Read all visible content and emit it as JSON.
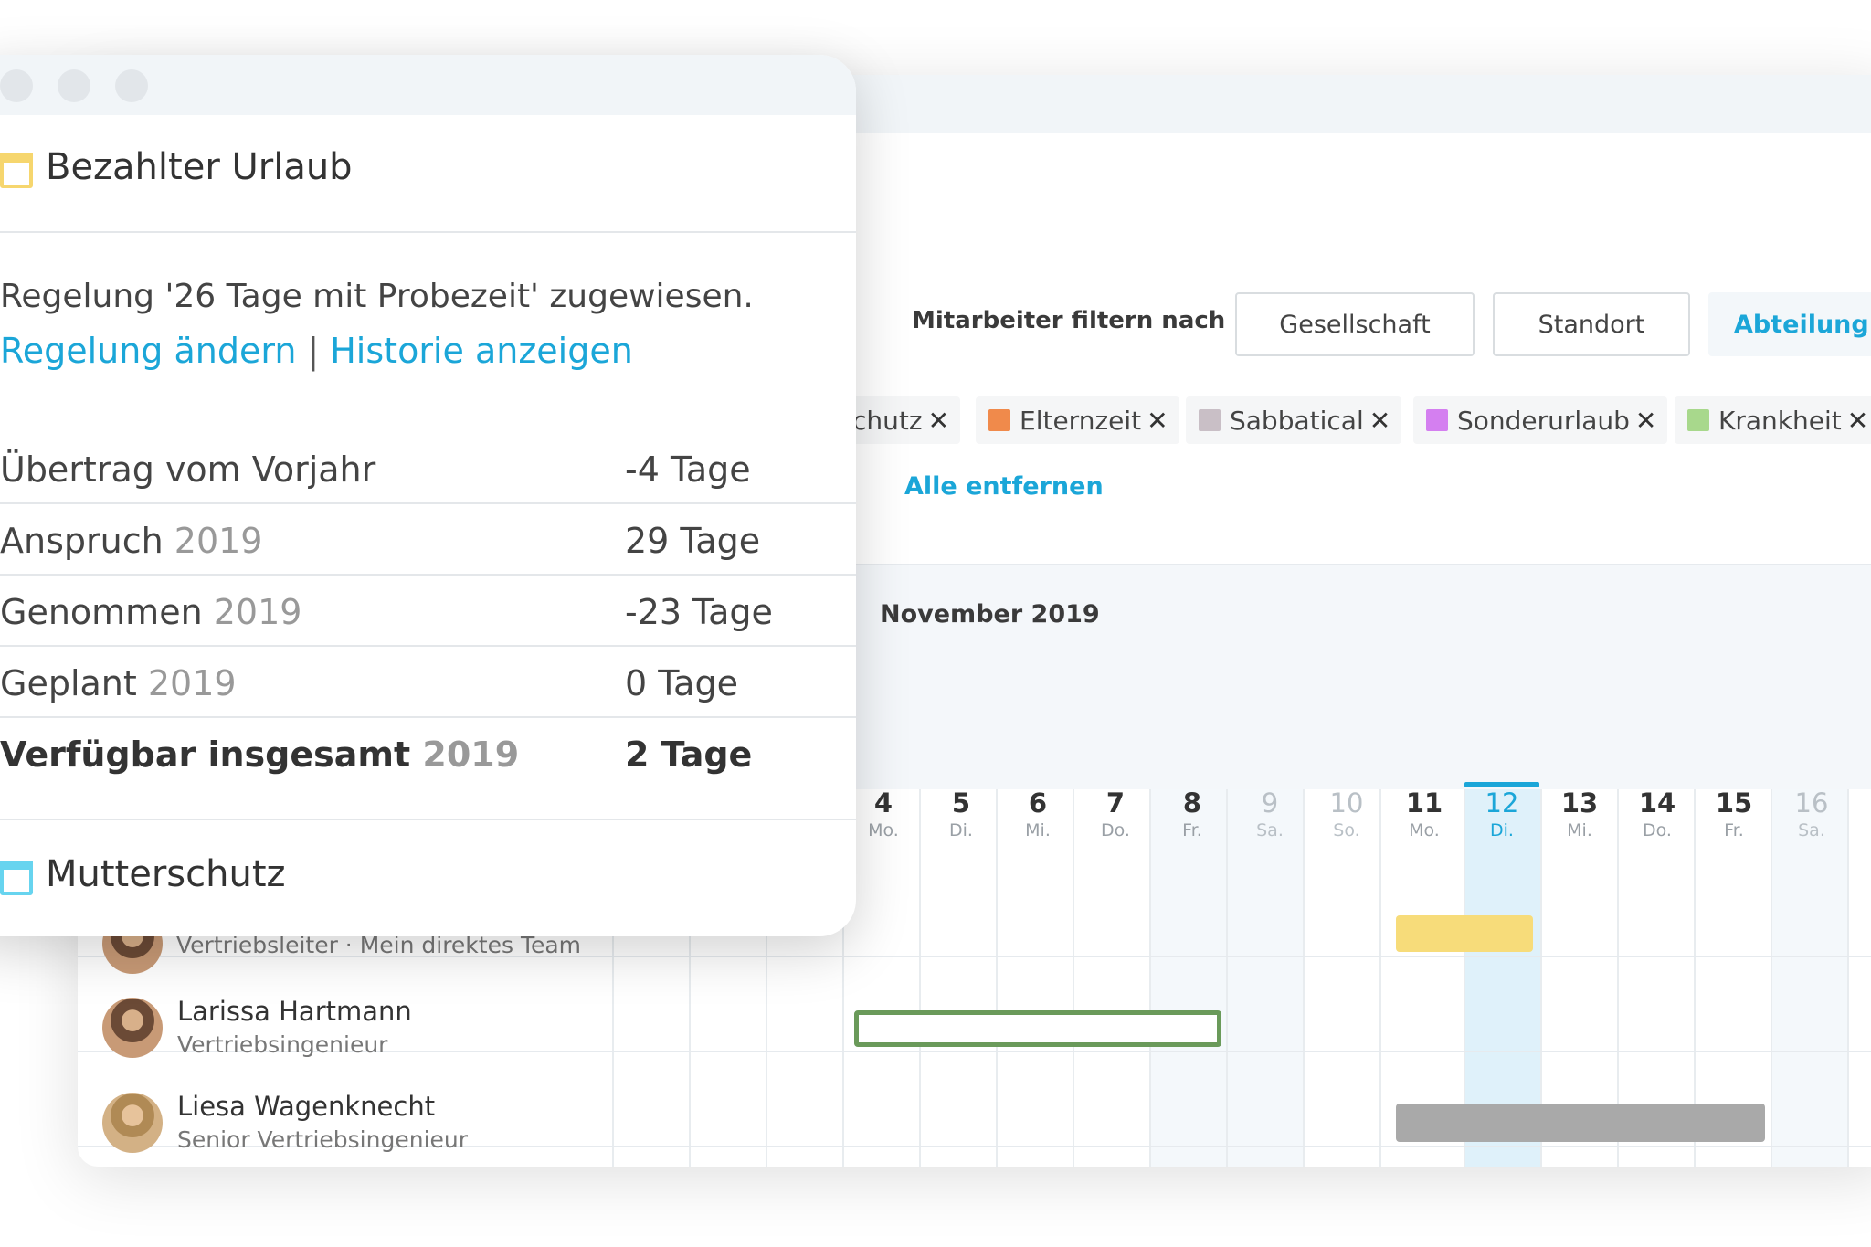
{
  "filter": {
    "label": "Mitarbeiter filtern nach",
    "buttons": [
      "Gesellschaft",
      "Standort",
      "Abteilung ("
    ]
  },
  "chips": [
    {
      "label": "chutz",
      "color": ""
    },
    {
      "label": "Elternzeit",
      "color": "#f08a4b"
    },
    {
      "label": "Sabbatical",
      "color": "#c9bfc6"
    },
    {
      "label": "Sonderurlaub",
      "color": "#d47ff0"
    },
    {
      "label": "Krankheit",
      "color": "#a8d88c"
    }
  ],
  "chip_close": "✕",
  "remove_all": "Alle entfernen",
  "calendar": {
    "month": "November 2019",
    "days": [
      {
        "n": "4",
        "d": "Mo."
      },
      {
        "n": "5",
        "d": "Di."
      },
      {
        "n": "6",
        "d": "Mi."
      },
      {
        "n": "7",
        "d": "Do."
      },
      {
        "n": "8",
        "d": "Fr."
      },
      {
        "n": "9",
        "d": "Sa."
      },
      {
        "n": "10",
        "d": "So."
      },
      {
        "n": "11",
        "d": "Mo."
      },
      {
        "n": "12",
        "d": "Di."
      },
      {
        "n": "13",
        "d": "Mi."
      },
      {
        "n": "14",
        "d": "Do."
      },
      {
        "n": "15",
        "d": "Fr."
      },
      {
        "n": "16",
        "d": "Sa."
      }
    ]
  },
  "employees": [
    {
      "name": "",
      "role": "Vertriebsleiter · Mein direktes Team"
    },
    {
      "name": "Larissa Hartmann",
      "role": "Vertriebsingenieur"
    },
    {
      "name": "Liesa Wagenknecht",
      "role": "Senior Vertriebsingenieur"
    }
  ],
  "popup": {
    "section1_title": "Bezahlter Urlaub",
    "rule_text": "Regelung '26 Tage mit Probezeit' zugewiesen.",
    "link_change": "Regelung ändern",
    "link_sep": "|",
    "link_history": "Historie anzeigen",
    "balance": [
      {
        "label": "Übertrag vom Vorjahr",
        "year": "",
        "value": "-4 Tage"
      },
      {
        "label": "Anspruch",
        "year": "2019",
        "value": "29 Tage"
      },
      {
        "label": "Genommen",
        "year": "2019",
        "value": "-23 Tage"
      },
      {
        "label": "Geplant",
        "year": "2019",
        "value": "0 Tage"
      },
      {
        "label": "Verfügbar insgesamt",
        "year": "2019",
        "value": "2 Tage"
      }
    ],
    "section2_title": "Mutterschutz"
  },
  "colors": {
    "accent": "#1ba6d8",
    "vacation_icon": "#f6d66e",
    "maternity_icon": "#67d4ef",
    "bar_yellow": "#f7dc7a",
    "bar_green_outline": "#6a9a5a",
    "bar_gray": "#a9a9a9"
  }
}
